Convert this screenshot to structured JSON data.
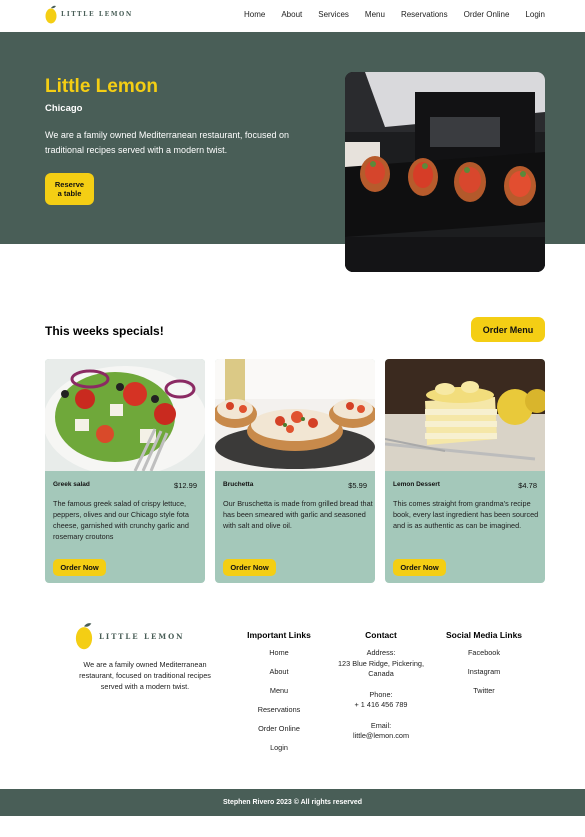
{
  "header": {
    "logo_text": "LITTLE LEMON",
    "nav": [
      "Home",
      "About",
      "Services",
      "Menu",
      "Reservations",
      "Order Online",
      "Login"
    ]
  },
  "hero": {
    "title": "Little Lemon",
    "city": "Chicago",
    "description": "We are a family owned Mediterranean restaurant, focused on traditional recipes served with a modern twist.",
    "reserve_line1": "Reserve",
    "reserve_line2": "a table"
  },
  "specials": {
    "title": "This weeks specials!",
    "order_menu": "Order Menu",
    "items": [
      {
        "name": "Greek salad",
        "price": "$12.99",
        "description": "The famous greek salad of crispy lettuce, peppers, olives and our Chicago style fota cheese, garnished with crunchy garlic and rosemary croutons",
        "button": "Order Now"
      },
      {
        "name": "Bruchetta",
        "price": "$5.99",
        "description": "Our Bruschetta is made from grilled bread that has been smeared with garlic and seasoned with salt and olive oil.",
        "button": "Order Now"
      },
      {
        "name": "Lemon Dessert",
        "price": "$4.78",
        "description": "This comes straight from grandma's recipe book, every last ingredient has been sourced and is as authentic as can be imagined.",
        "button": "Order Now"
      }
    ]
  },
  "footer": {
    "logo_text": "LITTLE LEMON",
    "about": "We are a family owned Mediterranean restaurant, focused on traditional recipes served with a modern twist.",
    "links_title": "Important Links",
    "links": [
      "Home",
      "About",
      "Menu",
      "Reservations",
      "Order Online",
      "Login"
    ],
    "contact_title": "Contact",
    "address_label": "Address:",
    "address_line1": "123 Blue Ridge, Pickering,",
    "address_line2": "Canada",
    "phone_label": "Phone:",
    "phone": "+ 1 416 456 789",
    "email_label": "Email:",
    "email": "little@lemon.com",
    "social_title": "Social Media Links",
    "social": [
      "Facebook",
      "Instagram",
      "Twitter"
    ],
    "copyright": "Stephen Rivero 2023 © All rights reserved"
  },
  "colors": {
    "primary_green": "#495e57",
    "primary_yellow": "#f4ce14",
    "card_green": "#a4c8ba"
  }
}
